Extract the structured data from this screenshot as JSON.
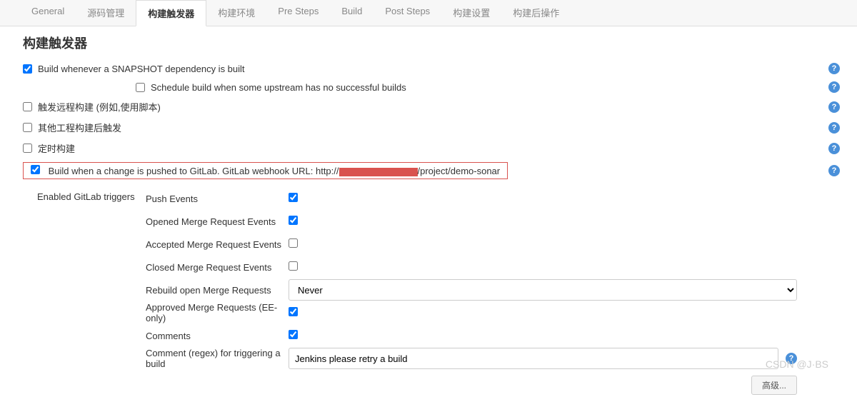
{
  "tabs": [
    "General",
    "源码管理",
    "构建触发器",
    "构建环境",
    "Pre Steps",
    "Build",
    "Post Steps",
    "构建设置",
    "构建后操作"
  ],
  "activeTabIndex": 2,
  "section": {
    "title": "构建触发器",
    "items": {
      "snapshot": {
        "label": "Build whenever a SNAPSHOT dependency is built",
        "checked": true,
        "sub": {
          "schedule_label": "Schedule build when some upstream has no successful builds",
          "schedule_checked": false
        }
      },
      "remote": {
        "label": "触发远程构建 (例如,使用脚本)",
        "checked": false
      },
      "after": {
        "label": "其他工程构建后触发",
        "checked": false
      },
      "timer": {
        "label": "定时构建",
        "checked": false
      },
      "gitlab": {
        "prefix": "Build when a change is pushed to GitLab. GitLab webhook URL: http://",
        "suffix": "/project/demo-sonar",
        "checked": true
      }
    },
    "enabled_triggers": {
      "label": "Enabled GitLab triggers",
      "push": {
        "label": "Push Events",
        "checked": true
      },
      "opened_mr": {
        "label": "Opened Merge Request Events",
        "checked": true
      },
      "accepted_mr": {
        "label": "Accepted Merge Request Events",
        "checked": false
      },
      "closed_mr": {
        "label": "Closed Merge Request Events",
        "checked": false
      },
      "rebuild_mr": {
        "label": "Rebuild open Merge Requests",
        "value": "Never"
      },
      "approved_mr": {
        "label": "Approved Merge Requests (EE-only)",
        "checked": true
      },
      "comments": {
        "label": "Comments",
        "checked": true
      },
      "comment_regex": {
        "label": "Comment (regex) for triggering a build",
        "value": "Jenkins please retry a build"
      }
    },
    "advanced_label": "高级..."
  },
  "watermark": "CSDN @J·BS"
}
